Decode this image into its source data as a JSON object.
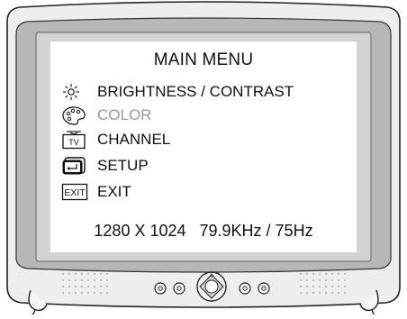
{
  "menu": {
    "title": "MAIN MENU",
    "items": [
      {
        "icon": "sun-icon",
        "label": "BRIGHTNESS / CONTRAST",
        "enabled": true
      },
      {
        "icon": "palette-icon",
        "label": "COLOR",
        "enabled": false
      },
      {
        "icon": "tv-icon",
        "label": "CHANNEL",
        "enabled": true,
        "icon_text": "TV"
      },
      {
        "icon": "setup-icon",
        "label": "SETUP",
        "enabled": true
      },
      {
        "icon": "exit-icon",
        "label": "EXIT",
        "enabled": true,
        "icon_text": "EXIT"
      }
    ],
    "status": "1280 X 1024   79.9KHz / 75Hz"
  },
  "colors": {
    "bezel": "#e6e6e6",
    "screen_frame": "#b5b5b5",
    "screen_inner": "#d4d4d4",
    "menu_bg": "#ffffff",
    "text": "#111111",
    "disabled_text": "#9a9a9a"
  }
}
